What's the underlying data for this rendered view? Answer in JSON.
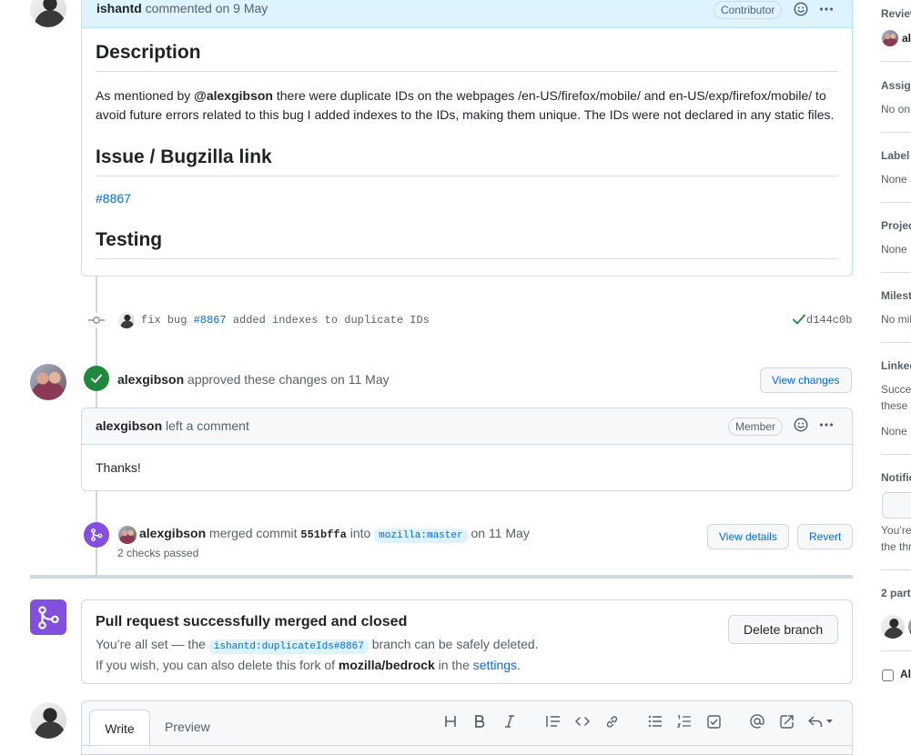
{
  "comment": {
    "author": "ishantd",
    "action": "commented on 9 May",
    "role": "Contributor",
    "heading_description": "Description",
    "body_pre": "As mentioned by ",
    "mention": "@alexgibson",
    "body_post": " there were duplicate IDs on the webpages /en-US/firefox/mobile/ and en-US/exp/firefox/mobile/ to avoid future errors related to this bug I added indexes to the IDs, making them unique. The IDs were not declared in any static files.",
    "heading_issue": "Issue / Bugzilla link",
    "issue_link": "#8867",
    "heading_testing": "Testing"
  },
  "commit": {
    "message_pre": "fix bug ",
    "issue_ref": "#8867",
    "message_post": " added indexes to duplicate IDs",
    "sha": "d144c0b"
  },
  "review": {
    "author": "alexgibson",
    "action": "approved these changes",
    "date": "on 11 May",
    "view_changes": "View changes"
  },
  "review_comment": {
    "author": "alexgibson",
    "action": "left a comment",
    "role": "Member",
    "body": "Thanks!"
  },
  "merge": {
    "author": "alexgibson",
    "action": "merged commit",
    "sha": "551bffa",
    "into": "into",
    "branch": "mozilla:master",
    "date": "on 11 May",
    "checks": "2 checks passed",
    "view_details": "View details",
    "revert": "Revert"
  },
  "merged_box": {
    "title": "Pull request successfully merged and closed",
    "line1_pre": "You’re all set — the",
    "branch": "ishantd:duplicateIds#8867",
    "line1_post": "branch can be safely deleted.",
    "line2_pre": "If you wish, you can also delete this fork of",
    "repo": "mozilla/bedrock",
    "line2_mid": "in the",
    "settings_link": "settings",
    "line2_end": ".",
    "delete_button": "Delete branch"
  },
  "editor": {
    "tab_write": "Write",
    "tab_preview": "Preview"
  },
  "sidebar": {
    "reviewers": "Review",
    "reviewer_initial": "al",
    "assignees": "Assig",
    "assignees_value": "No on",
    "labels": "Label",
    "labels_value": "None",
    "projects": "Projec",
    "projects_value": "None",
    "milestone": "Milest",
    "milestone_value": "No mil",
    "linked": "Linked",
    "linked_value1": "Succe",
    "linked_value2": "these",
    "linked_value3": "None",
    "notifications": "Notific",
    "notif_text1": "You’re",
    "notif_text2": "the thr",
    "participants": "2 part",
    "allow_edits": "Al"
  },
  "colors": {
    "accent": "#0969da",
    "success": "#1f883d",
    "merged": "#8250df"
  }
}
